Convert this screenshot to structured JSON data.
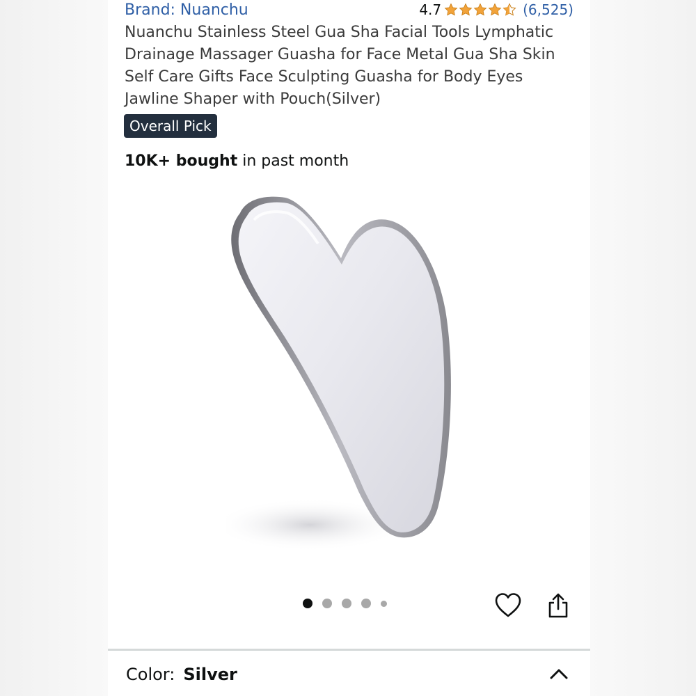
{
  "brand": {
    "label": "Brand: Nuanchu"
  },
  "rating": {
    "value": "4.7",
    "stars": 4.7,
    "count": "(6,525)",
    "star_color": "#f2a33a"
  },
  "product": {
    "title": "Nuanchu Stainless Steel Gua Sha Facial Tools Lymphatic Drainage Massager Guasha for Face Metal Gua Sha Skin Self Care Gifts Face Sculpting Guasha for Body Eyes Jawline Shaper with Pouch(Silver)",
    "badge": "Overall Pick",
    "bought_bold": "10K+ bought",
    "bought_rest": " in past month"
  },
  "gallery": {
    "image_icon": "gua-sha-tool-image",
    "dot_count": 5,
    "active_dot": 0
  },
  "actions": {
    "favorite_icon": "heart-icon",
    "share_icon": "share-icon"
  },
  "variation": {
    "label": "Color:",
    "value": "Silver",
    "toggle_icon": "chevron-up-icon"
  },
  "colors": {
    "link": "#2f5fa6",
    "badge_bg": "#232f3e",
    "text": "#0f1111"
  }
}
